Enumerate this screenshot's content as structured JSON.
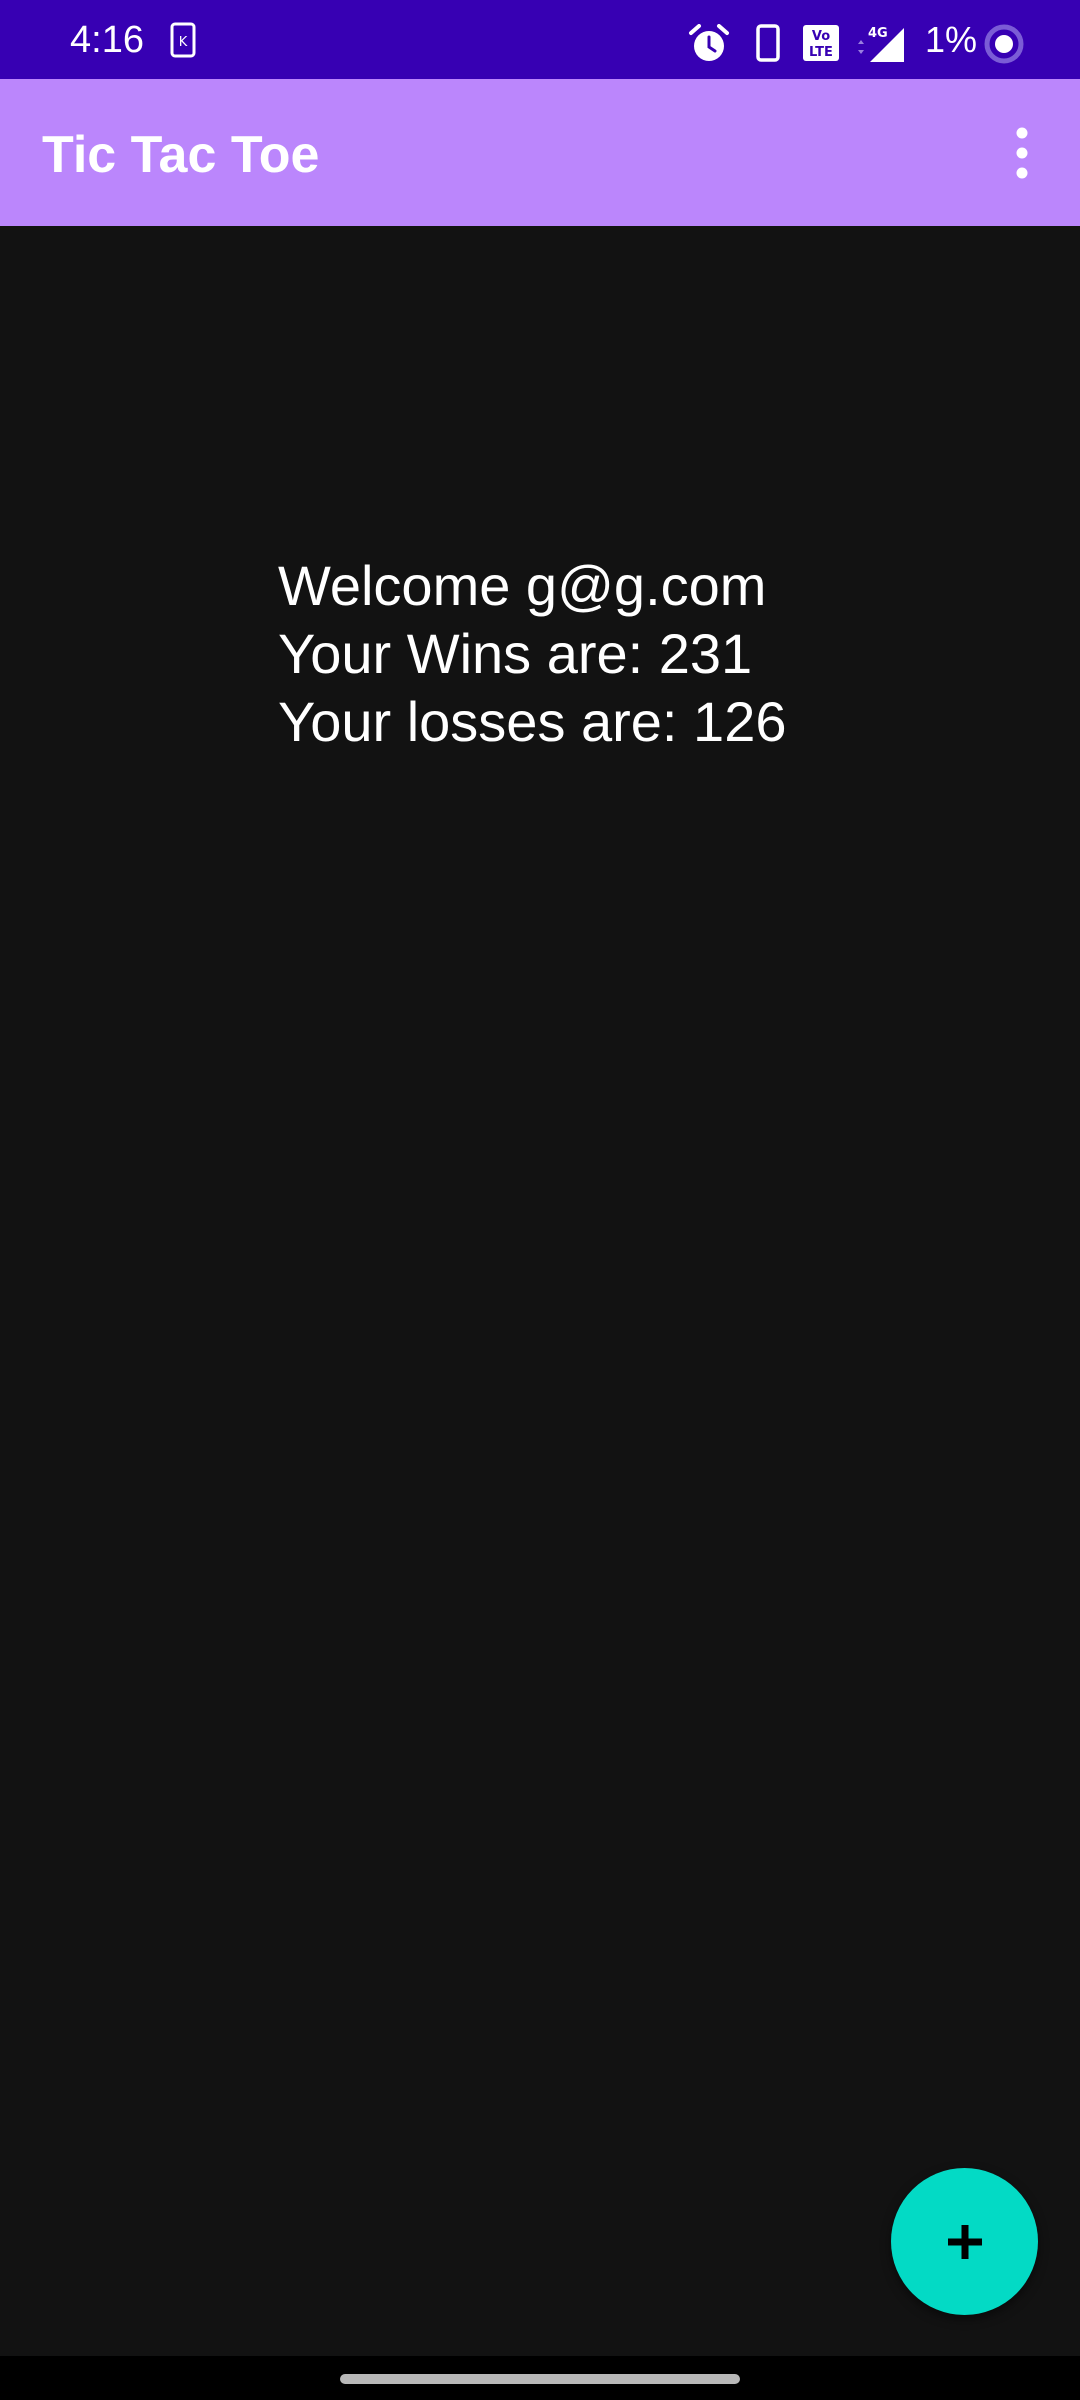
{
  "status_bar": {
    "time": "4:16",
    "battery_percent": "1%",
    "icons": [
      "sim-card-icon",
      "alarm-icon",
      "phone-icon",
      "volte-icon",
      "4g-signal-icon",
      "battery-ring-icon"
    ],
    "network_label": "4G",
    "volte_label": "Vo LTE"
  },
  "app_bar": {
    "title": "Tic Tac Toe",
    "menu_icon": "more-vert-icon"
  },
  "main": {
    "welcome": "Welcome g@g.com",
    "wins": "Your Wins are: 231",
    "losses": "Your losses are: 126"
  },
  "fab": {
    "icon": "add-icon"
  },
  "colors": {
    "status_bar": "#3700B3",
    "app_bar": "#BB86FC",
    "background": "#121212",
    "fab": "#03DAC5"
  }
}
